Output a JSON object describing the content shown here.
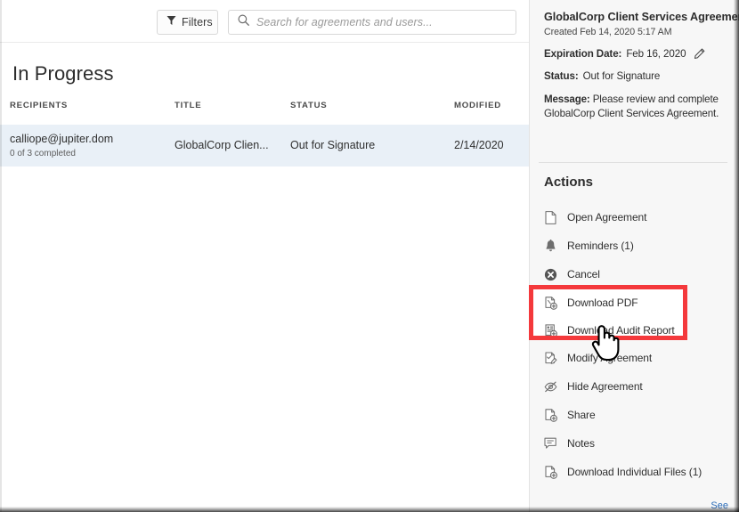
{
  "toolbar": {
    "filters_label": "Filters",
    "filter_icon": "funnel-icon",
    "search_icon": "search-icon",
    "search_placeholder": "Search for agreements and users...",
    "search_value": ""
  },
  "list": {
    "title": "In Progress",
    "columns": [
      "RECIPIENTS",
      "TITLE",
      "STATUS",
      "MODIFIED"
    ],
    "rows": [
      {
        "recipient": "calliope@jupiter.dom",
        "progress": "0 of 3 completed",
        "title": "GlobalCorp Clien...",
        "status": "Out for Signature",
        "modified": "2/14/2020",
        "selected": true
      }
    ]
  },
  "detail": {
    "title": "GlobalCorp Client Services Agreement",
    "created": "Created Feb 14, 2020 5:17 AM",
    "expiration_label": "Expiration Date:",
    "expiration_value": "Feb 16, 2020",
    "edit_icon": "pencil-icon",
    "status_label": "Status:",
    "status_value": "Out for Signature",
    "message_label": "Message:",
    "message_value": "Please review and complete GlobalCorp Client Services Agreement."
  },
  "actions": {
    "heading": "Actions",
    "items": [
      {
        "label": "Open Agreement",
        "icon": "document-icon"
      },
      {
        "label": "Reminders (1)",
        "icon": "bell-icon"
      },
      {
        "label": "Cancel",
        "icon": "cancel-circle-icon"
      },
      {
        "label": "Download PDF",
        "icon": "document-download-icon"
      },
      {
        "label": "Download Audit Report",
        "icon": "report-download-icon"
      },
      {
        "label": "Modify Agreement",
        "icon": "document-edit-icon"
      },
      {
        "label": "Hide Agreement",
        "icon": "eye-slash-icon"
      },
      {
        "label": "Share",
        "icon": "document-add-icon"
      },
      {
        "label": "Notes",
        "icon": "speech-bubble-icon"
      },
      {
        "label": "Download Individual Files (1)",
        "icon": "document-add-icon"
      }
    ],
    "see_link": "See"
  },
  "annotation": {
    "highlight_color": "#f4393c",
    "cursor_icon": "hand-pointer-cursor"
  },
  "colors": {
    "panel_bg": "#f7f7f7",
    "row_selected": "#e9f0f7",
    "link": "#2b6cb8",
    "text": "#2f2f2f"
  }
}
